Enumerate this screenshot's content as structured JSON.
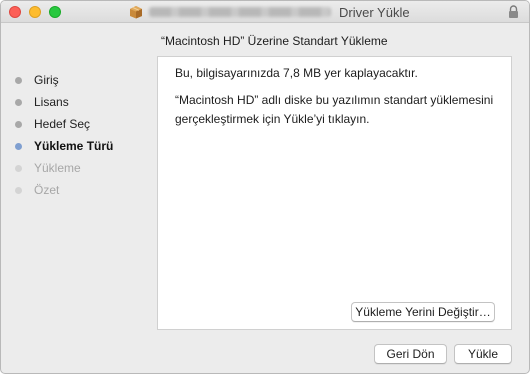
{
  "window": {
    "title": "Driver Yükle",
    "controls": [
      "close",
      "minimize",
      "zoom"
    ],
    "app_icon": "installer-box-icon",
    "lock_icon": "lock-icon"
  },
  "page": {
    "heading": "“Macintosh HD” Üzerine Standart Yükleme"
  },
  "steps": [
    {
      "label": "Giriş",
      "state": "done"
    },
    {
      "label": "Lisans",
      "state": "done"
    },
    {
      "label": "Hedef Seç",
      "state": "done"
    },
    {
      "label": "Yükleme Türü",
      "state": "current"
    },
    {
      "label": "Yükleme",
      "state": "future"
    },
    {
      "label": "Özet",
      "state": "future"
    }
  ],
  "content": {
    "line1": "Bu, bilgisayarınızda 7,8 MB yer kaplayacaktır.",
    "line2": "“Macintosh HD” adlı diske bu yazılımın standart yüklemesini gerçekleştirmek için Yükle’yi tıklayın.",
    "change_location_button": "Yükleme Yerini Değiştir…"
  },
  "footer": {
    "back_button": "Geri Dön",
    "install_button": "Yükle"
  },
  "colors": {
    "close": "#fc5f57",
    "minimize": "#fdbc2e",
    "zoom": "#29c840",
    "current_step_dot": "#7f9fd0"
  }
}
